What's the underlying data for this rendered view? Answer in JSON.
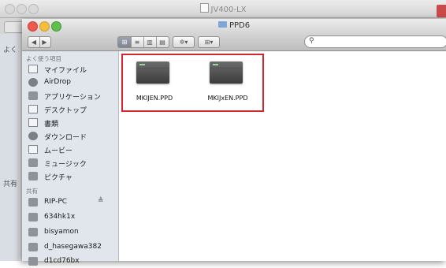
{
  "back_window": {
    "title": "JV400-LX",
    "sidebar_visible_fragments": [
      "よく",
      "共有"
    ]
  },
  "window": {
    "title": "PPD6"
  },
  "toolbar": {
    "search_placeholder": "",
    "search_icon": "magnifier-icon",
    "view_modes": [
      "icon-view",
      "list-view",
      "column-view",
      "coverflow-view"
    ],
    "active_view": "icon-view",
    "action_menu_icon": "gear-icon",
    "arrange_menu_icon": "grid-icon"
  },
  "sidebar": {
    "favorites_label": "よく使う項目",
    "favorites": [
      {
        "label": "マイファイル",
        "icon": "all-files-icon"
      },
      {
        "label": "AirDrop",
        "icon": "airdrop-icon"
      },
      {
        "label": "アプリケーション",
        "icon": "applications-icon"
      },
      {
        "label": "デスクトップ",
        "icon": "desktop-icon"
      },
      {
        "label": "書類",
        "icon": "documents-icon"
      },
      {
        "label": "ダウンロード",
        "icon": "downloads-icon"
      },
      {
        "label": "ムービー",
        "icon": "movies-icon"
      },
      {
        "label": "ミュージック",
        "icon": "music-icon"
      },
      {
        "label": "ピクチャ",
        "icon": "pictures-icon"
      }
    ],
    "shared_label": "共有",
    "shared": [
      {
        "label": "RIP-PC",
        "icon": "computer-icon",
        "eject": "≜"
      },
      {
        "label": "634hk1x",
        "icon": "computer-icon"
      },
      {
        "label": "bisyamon",
        "icon": "computer-icon"
      },
      {
        "label": "d_hasegawa382",
        "icon": "computer-icon"
      },
      {
        "label": "d1cd76bx",
        "icon": "computer-icon"
      }
    ]
  },
  "files": [
    {
      "name": "MKIJEN.PPD"
    },
    {
      "name": "MKIJxEN.PPD"
    }
  ],
  "colors": {
    "highlight": "#d4262e",
    "sidebar_bg": "#e1e6ed",
    "close": "#ee5a4f",
    "minimize": "#f5be3c",
    "zoom": "#5fc04e"
  }
}
